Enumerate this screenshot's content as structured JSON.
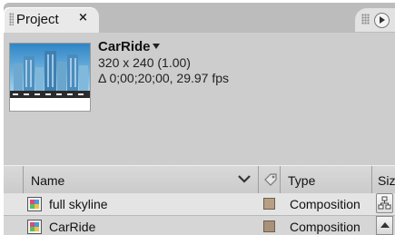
{
  "panel": {
    "tab_label": "Project",
    "tab_close": "×"
  },
  "preview": {
    "comp_name": "CarRide",
    "dimensions": "320 x 240 (1.00)",
    "info": "Δ 0;00;20;00, 29.97 fps"
  },
  "columns": {
    "name": "Name",
    "type": "Type",
    "size": "Size"
  },
  "items": [
    {
      "name": "full skyline",
      "type": "Composition",
      "label_color": "#b79f86"
    },
    {
      "name": "CarRide",
      "type": "Composition",
      "label_color": "#a8917a"
    }
  ],
  "icons": {
    "tab_grip": "grip-icon",
    "panel_menu": "panel-menu-icon",
    "sort": "chevron-down-icon",
    "label_column": "tag-icon",
    "composition": "composition-icon",
    "flowchart": "flowchart-icon",
    "scroll_up": "scroll-up-arrow"
  }
}
